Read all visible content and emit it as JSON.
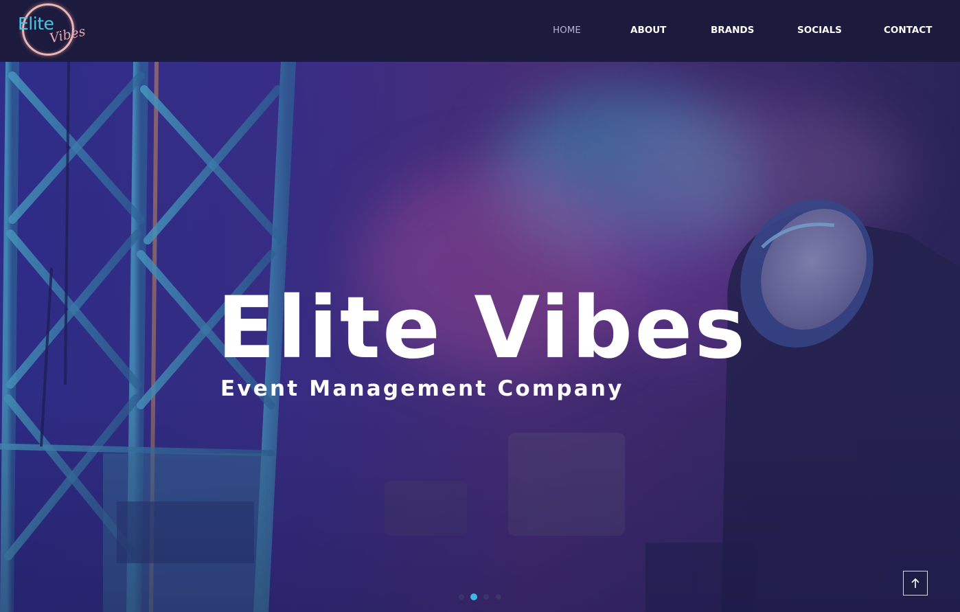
{
  "brand": {
    "logo_word_1": "Elite",
    "logo_word_2": "Vibes"
  },
  "nav": {
    "items": [
      {
        "label": "HOME",
        "active": true
      },
      {
        "label": "ABOUT",
        "active": false
      },
      {
        "label": "BRANDS",
        "active": false
      },
      {
        "label": "SOCIALS",
        "active": false
      },
      {
        "label": "CONTACT",
        "active": false
      }
    ]
  },
  "hero": {
    "title": "Elite Vibes",
    "subtitle": "Event Management Company",
    "background_image": "stage-truss-and-spotlight",
    "slides_total": 4,
    "slide_active_index": 1
  },
  "controls": {
    "scroll_top_icon": "arrow-up-icon"
  },
  "colors": {
    "header_bg": "#1c1b3d",
    "accent_cyan": "#3fb8e0",
    "logo_ring": "#e7b7b3"
  }
}
